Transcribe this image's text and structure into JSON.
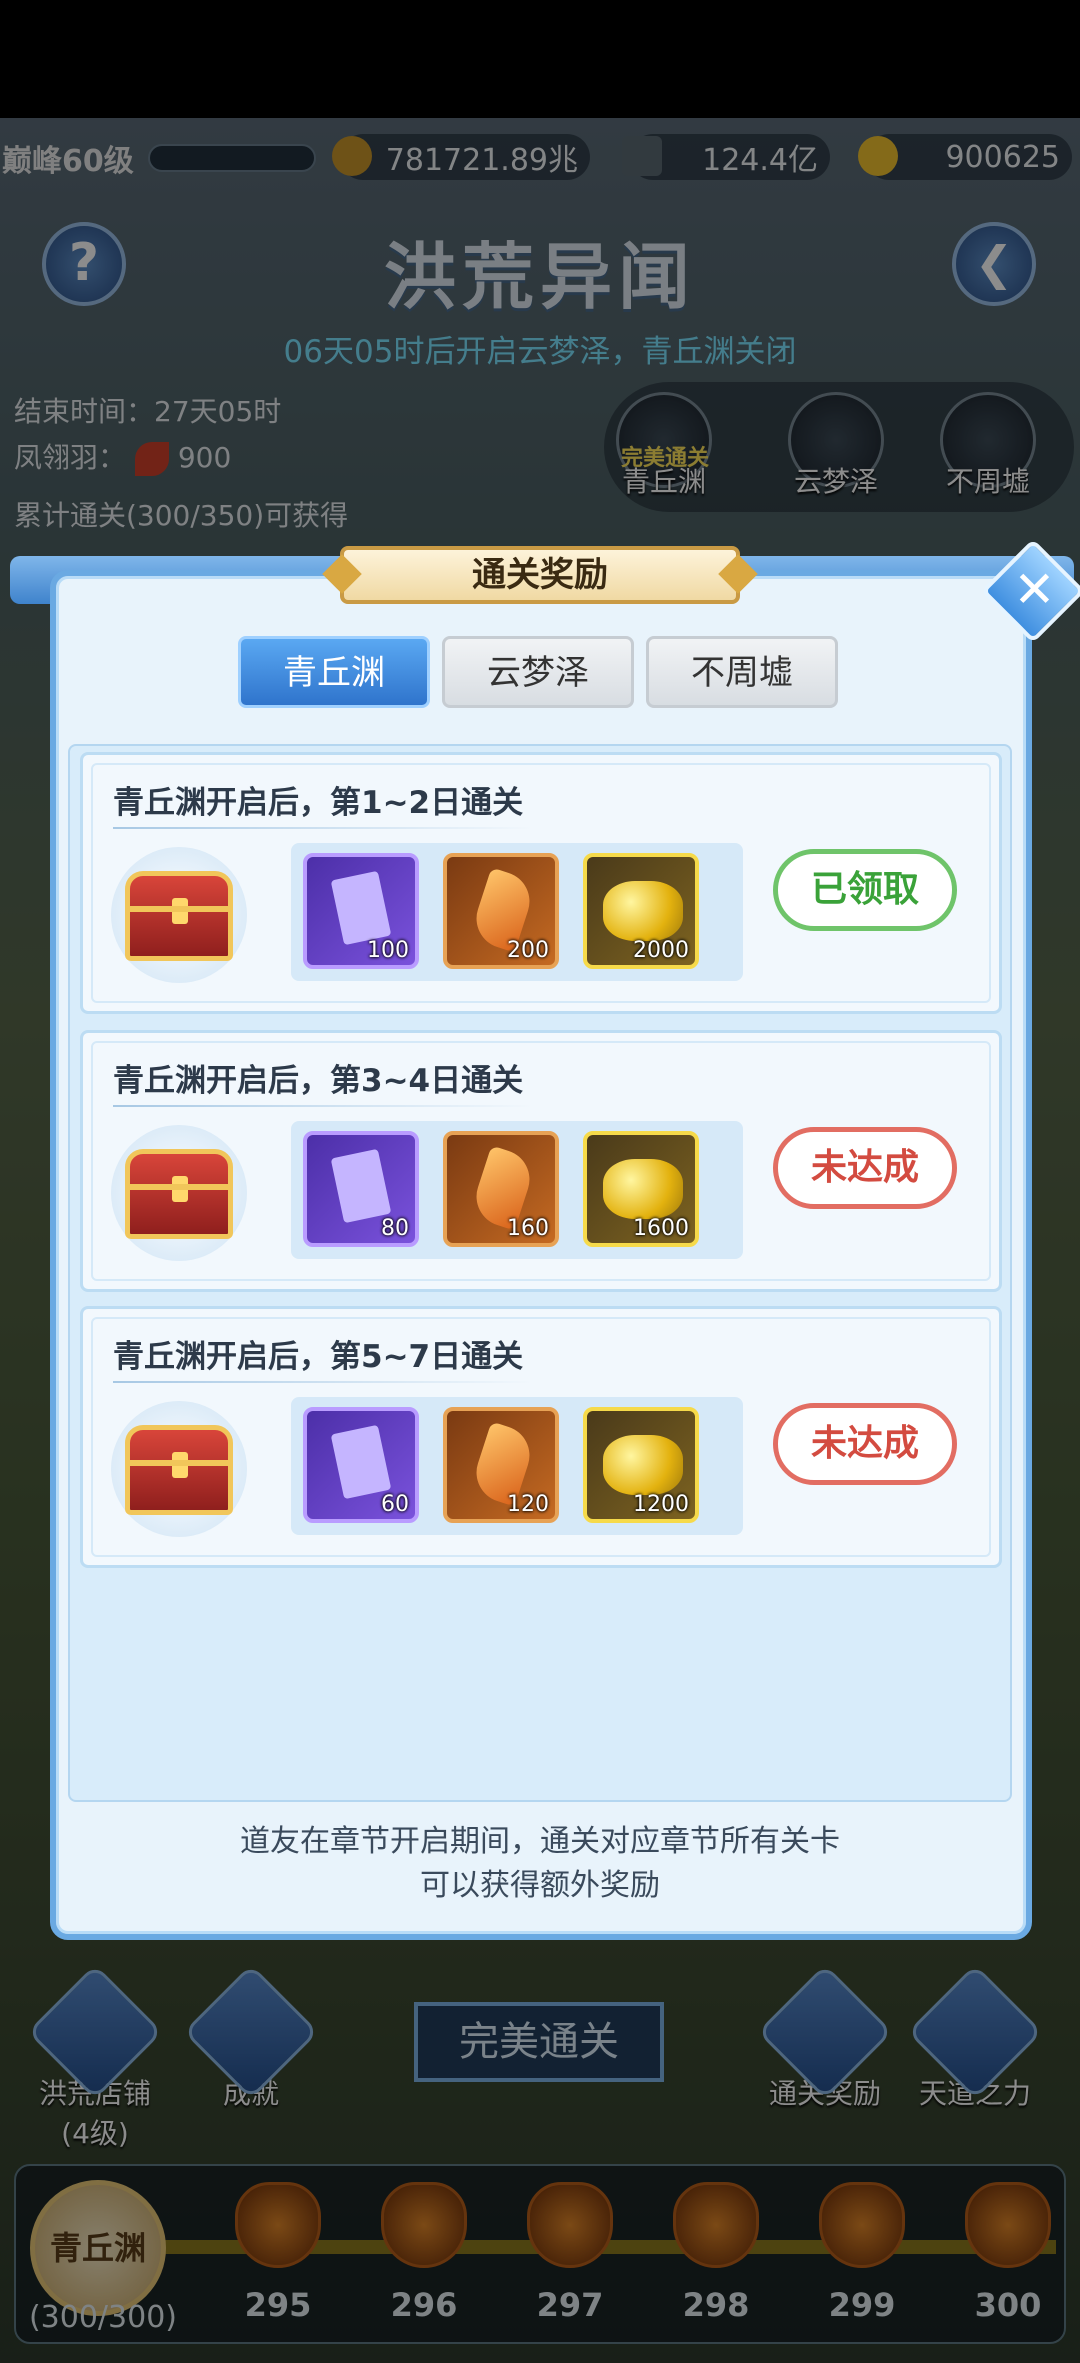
{
  "topbar": {
    "level": "巅峰60级",
    "combat_power": "781721.89兆",
    "coins": "124.4亿",
    "gold": "900625"
  },
  "header": {
    "title": "洪荒异闻",
    "subtitle": "06天05时后开启云梦泽，青丘渊关闭",
    "end_time": "结束时间：27天05时",
    "feather_label": "凤翎羽：",
    "feather_count": "900",
    "cumulative": "累计通关(300/350)可获得"
  },
  "chapters": [
    {
      "name": "青丘渊",
      "badge": "完美通关"
    },
    {
      "name": "云梦泽"
    },
    {
      "name": "不周墟"
    }
  ],
  "modal": {
    "title": "通关奖励",
    "close": "✕",
    "tabs": [
      "青丘渊",
      "云梦泽",
      "不周墟"
    ],
    "cards": [
      {
        "title": "青丘渊开启后，第1~2日通关",
        "items": [
          "100",
          "200",
          "2000"
        ],
        "status": "已领取"
      },
      {
        "title": "青丘渊开启后，第3~4日通关",
        "items": [
          "80",
          "160",
          "1600"
        ],
        "status": "未达成"
      },
      {
        "title": "青丘渊开启后，第5~7日通关",
        "items": [
          "60",
          "120",
          "1200"
        ],
        "status": "未达成"
      }
    ],
    "note_line1": "道友在章节开启期间，通关对应章节所有关卡",
    "note_line2": "可以获得额外奖励"
  },
  "bottom": {
    "perfect_button": "完美通关",
    "shop": "洪荒店铺",
    "shop_level": "(4级)",
    "achievement": "成就",
    "clear_reward": "通关奖励",
    "heaven_power": "天道之力",
    "current_node": "青丘渊",
    "current_progress": "(300/300)",
    "nodes": [
      "295",
      "296",
      "297",
      "298",
      "299",
      "300"
    ]
  }
}
